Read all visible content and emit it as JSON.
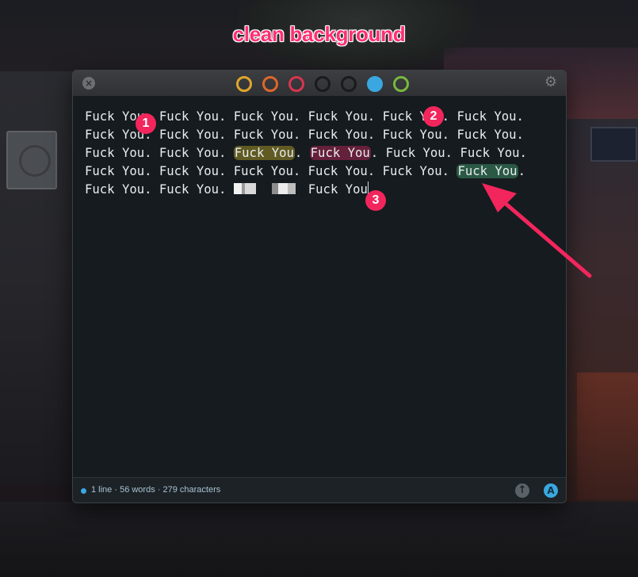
{
  "annotation": {
    "headline": "clean background"
  },
  "window": {
    "close_icon": "close-icon",
    "gear_icon": "gear-icon",
    "theme_swatches": [
      {
        "name": "theme-yellow",
        "color": "#e0a62a"
      },
      {
        "name": "theme-orange",
        "color": "#e0662a"
      },
      {
        "name": "theme-red",
        "color": "#d8354e"
      },
      {
        "name": "theme-black",
        "color": "#2a2a2a"
      },
      {
        "name": "theme-dark",
        "color": "#2a2a2a"
      },
      {
        "name": "theme-blue",
        "color": "#3aa7e0",
        "filled": true
      },
      {
        "name": "theme-green",
        "color": "#78b83c"
      }
    ]
  },
  "editor": {
    "lines": [
      [
        "Fuck You. ",
        "Fuck You. ",
        "Fuck You. ",
        "Fuck You. ",
        "Fuck You. ",
        "Fuck You."
      ],
      [
        "Fuck You. ",
        "Fuck You. ",
        "Fuck You. ",
        "Fuck You. ",
        "Fuck You. ",
        "Fuck You."
      ],
      [
        "Fuck You. ",
        "Fuck You. ",
        "Fuck You",
        ". ",
        "Fuck You",
        ". ",
        "Fuck You. ",
        "Fuck You."
      ],
      [
        "Fuck You. ",
        "Fuck You. ",
        "Fuck You. ",
        "Fuck You. ",
        "Fuck You. ",
        "Fuck You",
        "."
      ],
      [
        "Fuck You. ",
        "Fuck You. ",
        "Fuck You"
      ]
    ]
  },
  "status": {
    "text": "1 line · 56 words · 279 characters",
    "up_icon": "arrow-up-icon",
    "a_label": "A"
  },
  "badges": [
    "1",
    "2",
    "3"
  ],
  "colors": {
    "accent": "#f2265c",
    "highlight_yellow": "#bea628",
    "highlight_red": "#c8285a",
    "highlight_green": "#3c8c64"
  }
}
